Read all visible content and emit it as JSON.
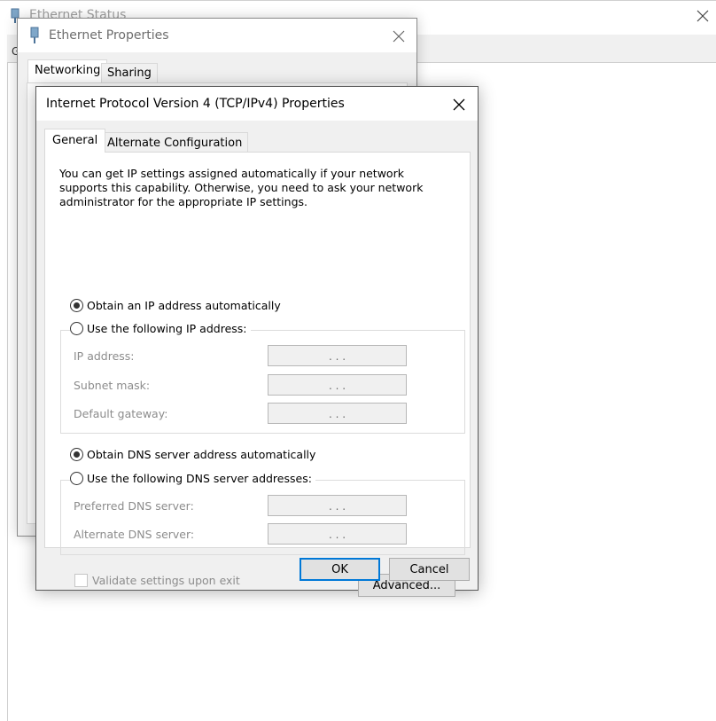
{
  "status_window": {
    "title": "Ethernet Status",
    "tab_fragment": "G"
  },
  "properties_window": {
    "title": "Ethernet Properties",
    "tabs": [
      {
        "label": "Networking",
        "active": true
      },
      {
        "label": "Sharing",
        "active": false
      }
    ]
  },
  "ipv4_dialog": {
    "title": "Internet Protocol Version 4 (TCP/IPv4) Properties",
    "tabs": [
      {
        "label": "General",
        "active": true
      },
      {
        "label": "Alternate Configuration",
        "active": false
      }
    ],
    "intro_text": "You can get IP settings assigned automatically if your network supports this capability. Otherwise, you need to ask your network administrator for the appropriate IP settings.",
    "ip_section": {
      "auto_label": "Obtain an IP address automatically",
      "auto_selected": true,
      "manual_label": "Use the following IP address:",
      "manual_selected": false,
      "fields": [
        {
          "label": "IP address:",
          "value": ".      .      ."
        },
        {
          "label": "Subnet mask:",
          "value": ".      .      ."
        },
        {
          "label": "Default gateway:",
          "value": ".      .      ."
        }
      ]
    },
    "dns_section": {
      "auto_label": "Obtain DNS server address automatically",
      "auto_selected": true,
      "manual_label": "Use the following DNS server addresses:",
      "manual_selected": false,
      "fields": [
        {
          "label": "Preferred DNS server:",
          "value": ".      .      ."
        },
        {
          "label": "Alternate DNS server:",
          "value": ".      .      ."
        }
      ]
    },
    "validate_label": "Validate settings upon exit",
    "validate_checked": false,
    "buttons": {
      "advanced": "Advanced...",
      "ok": "OK",
      "cancel": "Cancel"
    }
  },
  "colors": {
    "accent": "#0078d7",
    "dialog_bg": "#f0f0f0",
    "disabled_text": "#8c8c8c"
  }
}
